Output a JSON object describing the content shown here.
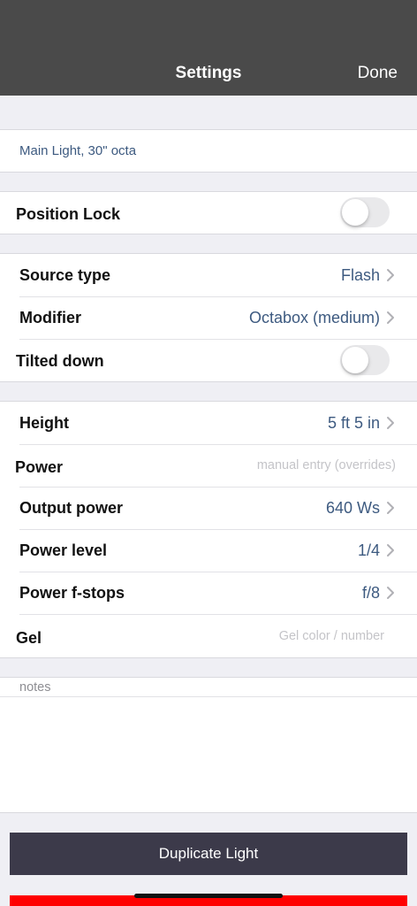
{
  "nav": {
    "title": "Settings",
    "done_label": "Done"
  },
  "light_name": "Main Light, 30\" octa",
  "position_lock": {
    "label": "Position Lock",
    "on": false
  },
  "source": {
    "type_label": "Source type",
    "type_value": "Flash",
    "modifier_label": "Modifier",
    "modifier_value": "Octabox (medium)",
    "tilted_label": "Tilted down",
    "tilted_on": false
  },
  "params": {
    "height_label": "Height",
    "height_value": "5 ft 5 in",
    "power_label": "Power",
    "power_placeholder": "manual entry (overrides)",
    "output_label": "Output power",
    "output_value": "640 Ws",
    "level_label": "Power level",
    "level_value": "1/4",
    "fstops_label": "Power f-stops",
    "fstops_value": "f/8",
    "gel_label": "Gel",
    "gel_placeholder": "Gel color / number"
  },
  "notes_placeholder": "notes",
  "duplicate_label": "Duplicate Light",
  "colors": {
    "nav_bg": "#4a4a4a",
    "value_blue": "#3d5a80",
    "button_bg": "#3c3a4a",
    "delete_red": "#ff0000"
  },
  "icons": [
    "chevron-right-icon"
  ]
}
